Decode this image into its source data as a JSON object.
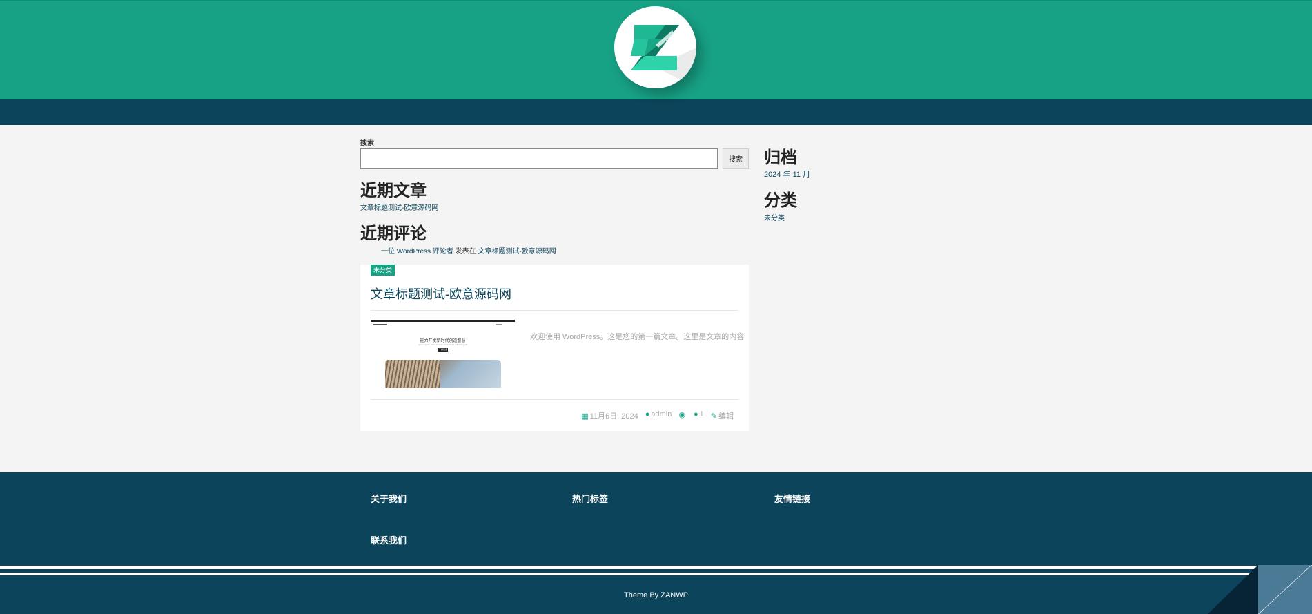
{
  "header": {
    "logo": "zanwp-logo"
  },
  "search": {
    "label": "搜索",
    "placeholder": "",
    "button": "搜索"
  },
  "recent_posts": {
    "heading": "近期文章",
    "items": [
      "文章标题测试-欧意源码网"
    ]
  },
  "recent_comments": {
    "heading": "近期评论",
    "author": "一位 WordPress 评论者",
    "connector": " 发表在 ",
    "post": "文章标题测试-欧意源码网"
  },
  "post": {
    "category": "未分类",
    "title": "文章标题测试-欧意源码网",
    "excerpt": "欢迎使用 WordPress。这是您的第一篇文章。这里是文章的内容",
    "meta": {
      "date": "11月6日, 2024",
      "author": "admin",
      "views": "",
      "comments": "1",
      "edit": "编辑"
    },
    "thumbnail": {
      "heading": "能力开发新时代创造智慧",
      "subtext": "Lorem ipsum dolor sit amet consectetur adipiscing elit",
      "button": "了解更多"
    }
  },
  "sidebar": {
    "archive_heading": "归档",
    "archive_items": [
      "2024 年 11 月"
    ],
    "category_heading": "分类",
    "category_items": [
      "未分类"
    ]
  },
  "footer": {
    "links": [
      "关于我们",
      "热门标签",
      "友情链接",
      "联系我们"
    ],
    "credit": "Theme By ZANWP"
  },
  "colors": {
    "brand_green": "#17a185",
    "navy": "#0c445b",
    "page_bg": "#f4f4f4"
  }
}
